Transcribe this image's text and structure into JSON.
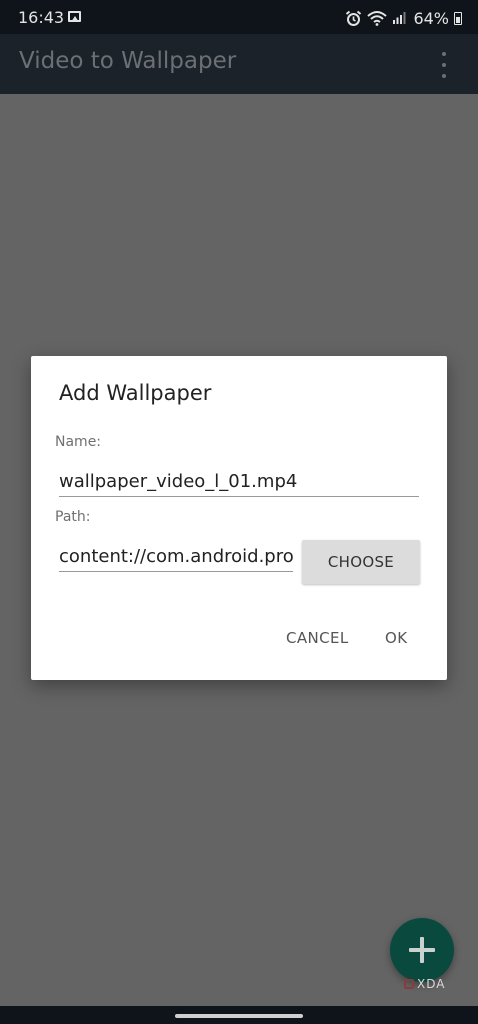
{
  "status_bar": {
    "time": "16:43",
    "battery_percent": "64%",
    "icons": [
      "gallery-icon",
      "alarm-icon",
      "wifi-icon",
      "signal-icon",
      "battery-icon"
    ]
  },
  "app_bar": {
    "title": "Video to Wallpaper",
    "menu_icon": "more-vert-icon"
  },
  "dialog": {
    "title": "Add Wallpaper",
    "name_label": "Name:",
    "name_value": "wallpaper_video_l_01.mp4",
    "path_label": "Path:",
    "path_value": "content://com.android.providers.media.documents",
    "choose_label": "CHOOSE",
    "cancel_label": "CANCEL",
    "ok_label": "OK"
  },
  "fab": {
    "icon": "plus-icon"
  },
  "watermark": {
    "text": "XDA"
  },
  "colors": {
    "scrim": "#646464",
    "app_bar": "#1b2229",
    "status_bar": "#0e1419",
    "fab": "#0a4a3e"
  }
}
